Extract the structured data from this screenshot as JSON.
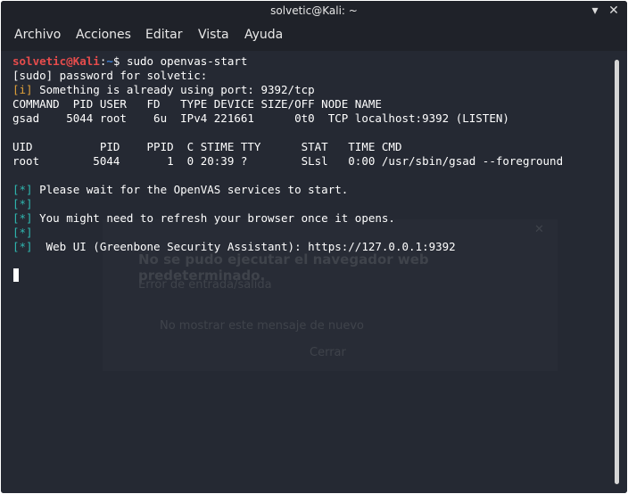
{
  "window": {
    "title": "solvetic@Kali: ~",
    "minimize_glyph": "▾",
    "close_glyph": "✕"
  },
  "menu": [
    "Archivo",
    "Acciones",
    "Editar",
    "Vista",
    "Ayuda"
  ],
  "terminal": {
    "prompt_user": "solvetic@Kali",
    "prompt_sep": ":",
    "prompt_path": "~",
    "prompt_dollar": "$ ",
    "command": "sudo openvas-start",
    "line_sudo": "[sudo] password for solvetic:",
    "info_tag": "[i]",
    "info_text": " Something is already using port: 9392/tcp",
    "lsof_header": "COMMAND  PID USER   FD   TYPE DEVICE SIZE/OFF NODE NAME",
    "lsof_row": "gsad    5044 root    6u  IPv4 221661      0t0  TCP localhost:9392 (LISTEN)",
    "ps_header": "UID          PID    PPID  C STIME TTY      STAT   TIME CMD",
    "ps_row": "root        5044       1  0 20:39 ?        SLsl   0:00 /usr/sbin/gsad --foreground",
    "star_tag": "[*]",
    "star1": " Please wait for the OpenVAS services to start.",
    "star3": " You might need to refresh your browser once it opens.",
    "star5": "  Web UI (Greenbone Security Assistant): https://127.0.0.1:9392"
  },
  "dialog": {
    "close_glyph": "✕",
    "title": "No se pudo ejecutar el navegador web predeterminado.",
    "detail": "Error de entrada/salida",
    "checkbox_label": "No mostrar este mensaje de nuevo",
    "button_label": "Cerrar"
  },
  "colors": {
    "terminal_bg": "#252933",
    "prompt_user": "#e74c4c",
    "prompt_path": "#3d7fd6",
    "info_tag": "#e0a13a",
    "star_tag": "#2fb8b0"
  }
}
